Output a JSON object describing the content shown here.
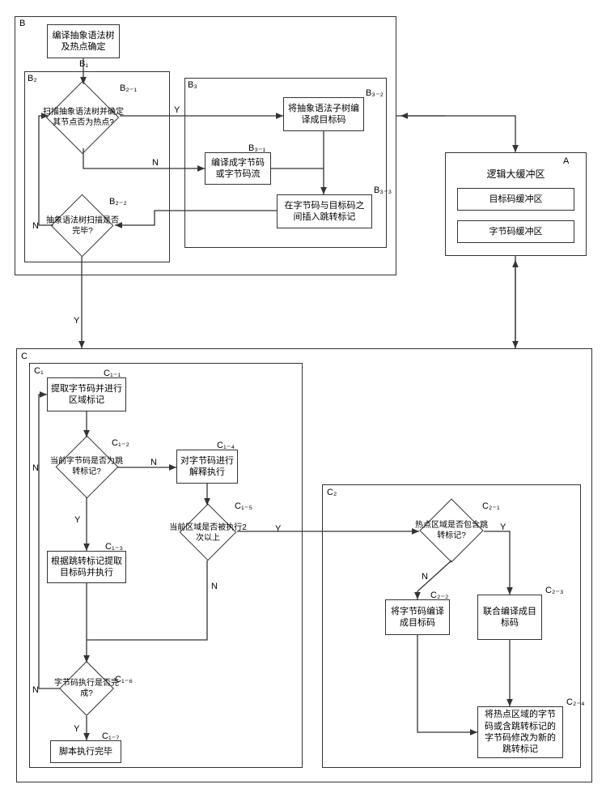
{
  "containers": {
    "B": "B",
    "B2": "B₂",
    "B3": "B₃",
    "A": "A",
    "C": "C",
    "C1": "C₁",
    "C2": "C₂"
  },
  "nodes": {
    "B1": {
      "label": "编译抽象语法树及热点确定",
      "id": "B₁"
    },
    "B2_1": {
      "label": "扫描抽象语法树并确定其节点否为热点?",
      "id": "B₂₋₁"
    },
    "B2_2": {
      "label": "抽象语法树扫描是否完毕?",
      "id": "B₂₋₂"
    },
    "B3_1": {
      "label": "编译成字节码或字节码流",
      "id": "B₃₋₁"
    },
    "B3_2": {
      "label": "将抽象语法子树编译成目标码",
      "id": "B₃₋₂"
    },
    "B3_3": {
      "label": "在字节码与目标码之间插入跳转标记",
      "id": "B₃₋₃"
    },
    "A_title": "逻辑大缓冲区",
    "A_sub1": "目标码缓冲区",
    "A_sub2": "字节码缓冲区",
    "C1_1": {
      "label": "提取字节码并进行区域标记",
      "id": "C₁₋₁"
    },
    "C1_2": {
      "label": "当前字节码是否为跳转标记?",
      "id": "C₁₋₂"
    },
    "C1_3": {
      "label": "根据跳转标记提取目标码并执行",
      "id": "C₁₋₃"
    },
    "C1_4": {
      "label": "对字节码进行解释执行",
      "id": "C₁₋₄"
    },
    "C1_5": {
      "label": "当前区域是否被执行2次以上",
      "id": "C₁₋₅"
    },
    "C1_6": {
      "label": "字节码执行是否完成?",
      "id": "C₁₋₆"
    },
    "C1_7": {
      "label": "脚本执行完毕",
      "id": "C₁₋₇"
    },
    "C2_1": {
      "label": "热点区域是否包含跳转标记?",
      "id": "C₂₋₁"
    },
    "C2_2": {
      "label": "将字节码编译成目标码",
      "id": "C₂₋₂"
    },
    "C2_3": {
      "label": "联合编译成目标码",
      "id": "C₂₋₃"
    },
    "C2_4": {
      "label": "将热点区域的字节码或含跳转标记的字节码修改为新的跳转标记",
      "id": "C₂₋₄"
    }
  },
  "edges": {
    "Y": "Y",
    "N": "N"
  }
}
